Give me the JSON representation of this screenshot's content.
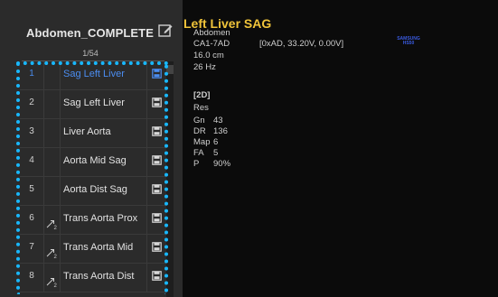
{
  "protocol": {
    "title": "Abdomen_COMPLETE",
    "counter": "1/54"
  },
  "items": [
    {
      "num": "1",
      "label": "Sag Left Liver",
      "selected": true
    },
    {
      "num": "2",
      "label": "Sag Left Liver"
    },
    {
      "num": "3",
      "label": "Liver Aorta"
    },
    {
      "num": "4",
      "label": "Aorta Mid Sag"
    },
    {
      "num": "5",
      "label": "Aorta Dist Sag"
    },
    {
      "num": "6",
      "label": "Trans Aorta Prox",
      "mark": "2"
    },
    {
      "num": "7",
      "label": "Trans Aorta Mid",
      "mark": "2"
    },
    {
      "num": "8",
      "label": "Trans Aorta Dist",
      "mark": "2"
    }
  ],
  "image": {
    "title": "Left Liver SAG",
    "exam": "Abdomen",
    "probe": "CA1-7AD",
    "probe_params": "[0xAD, 33.20V, 0.00V]",
    "depth": "16.0 cm",
    "frequency": "26 Hz",
    "mode": "[2D]",
    "res": "Res",
    "params": [
      {
        "label": "Gn",
        "value": "43"
      },
      {
        "label": "DR",
        "value": "136"
      },
      {
        "label": "Map",
        "value": "6"
      },
      {
        "label": "FA",
        "value": "5"
      },
      {
        "label": "P",
        "value": "90%"
      }
    ],
    "logo_line1": "SAMSUNG",
    "logo_line2": "HS50"
  },
  "colors": {
    "accent_selected": "#4b8df0",
    "title_yellow": "#f0c43a",
    "outline_cyan": "#18b8ff"
  }
}
